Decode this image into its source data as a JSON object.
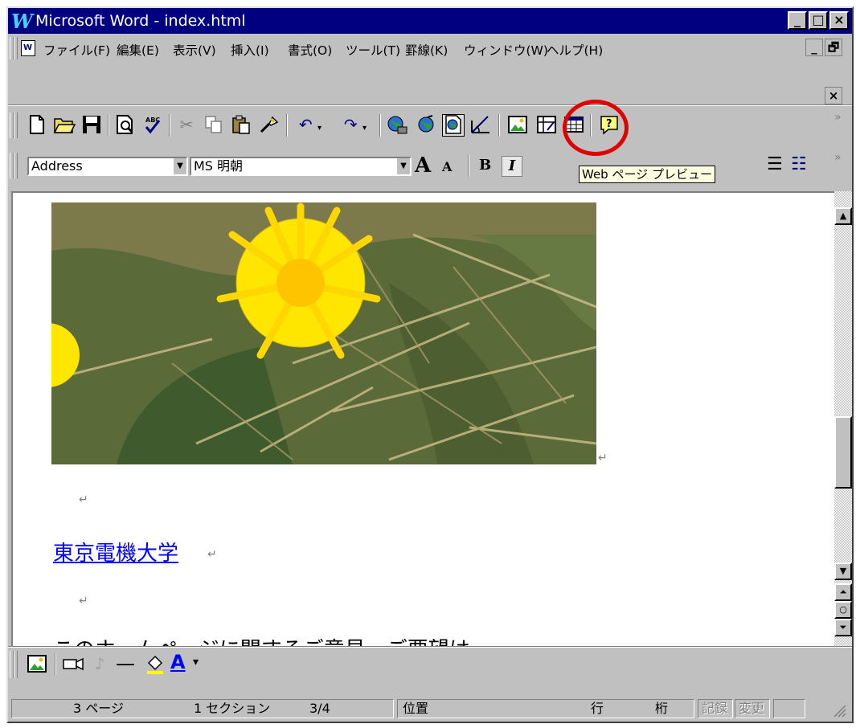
{
  "window": {
    "title": "Microsoft Word - index.html"
  },
  "title_buttons": {
    "minimize": "_",
    "maximize": "□",
    "close": "×"
  },
  "menu": {
    "doc_icon_label": "W",
    "items": [
      "ファイル(F)",
      "編集(E)",
      "表示(V)",
      "挿入(I)",
      "書式(O)",
      "ツール(T)",
      "罫線(K)",
      "ウィンドウ(W)",
      "ヘルプ(H)"
    ],
    "mdi_minimize": "_",
    "mdi_restore": "🗗",
    "mdi_close": "×"
  },
  "toolbar": {
    "icons": [
      "new-document-icon",
      "open-folder-icon",
      "save-disk-icon",
      "print-preview-icon",
      "spelling-icon",
      "cut-icon",
      "copy-icon",
      "paste-icon",
      "format-painter-icon",
      "undo-icon",
      "redo-icon",
      "web-browse-icon",
      "hyperlink-globe-icon",
      "web-page-preview-icon",
      "form-design-icon",
      "insert-picture-icon",
      "insert-table-icon",
      "insert-grid-icon",
      "help-icon"
    ],
    "more": "»"
  },
  "format_bar": {
    "style_value": "Address",
    "font_value": "MS 明朝",
    "grow_font": "A",
    "shrink_font": "A",
    "bold": "B",
    "italic": "I",
    "more": "»"
  },
  "tooltip": {
    "text": "Web ページ プレビュー"
  },
  "document": {
    "image_alt": "dandelion",
    "paragraph_mark": "↵",
    "link_text": "東京電機大学",
    "body_text": "このホームページに関するご意見・ご要望は"
  },
  "drawing_bar": {
    "line_label": "—",
    "font_color_label": "A",
    "dropdown": "▾"
  },
  "status": {
    "page": "3 ページ",
    "section": "1 セクション",
    "page_of": "3/4",
    "position": "位置",
    "line": "行",
    "column": "桁",
    "rec": "記録",
    "trk": "変更"
  },
  "colors": {
    "title_bg": "#000080",
    "link": "#0000ff",
    "ring": "#e00000",
    "tooltip_bg": "#ffffe1"
  }
}
